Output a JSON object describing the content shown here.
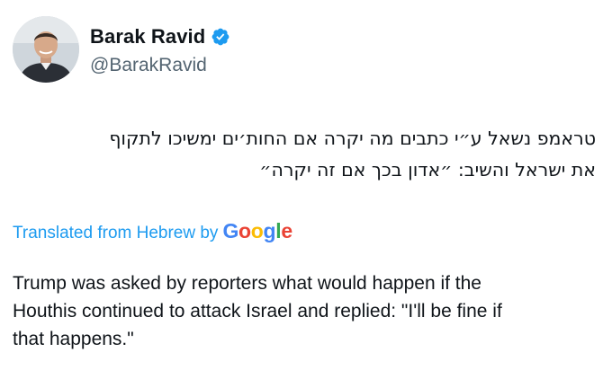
{
  "author": {
    "display_name": "Barak Ravid",
    "handle": "@BarakRavid",
    "verified": true,
    "avatar_icon": "profile-photo",
    "verified_icon": "verified-badge-icon",
    "verified_color": "#1d9bf0"
  },
  "tweet": {
    "original_text_lines": [
      "טראמפ נשאל ע״י כתבים מה יקרה אם החות׳ים ימשיכו לתקוף",
      "את ישראל והשיב: ״אדון בכך אם זה יקרה״"
    ],
    "translation_label": "Translated from Hebrew by",
    "translation_provider": [
      "G",
      "o",
      "o",
      "g",
      "l",
      "e"
    ],
    "translated_text_lines": [
      "Trump was asked by reporters what would happen if the",
      "Houthis continued to attack Israel and replied: \"I'll be fine if",
      "that happens.\""
    ]
  },
  "colors": {
    "link": "#1d9bf0",
    "handle": "#536471",
    "text": "#0f1419",
    "google_blue": "#4285f4",
    "google_red": "#ea4335",
    "google_yellow": "#fbbc05",
    "google_green": "#34a853"
  }
}
